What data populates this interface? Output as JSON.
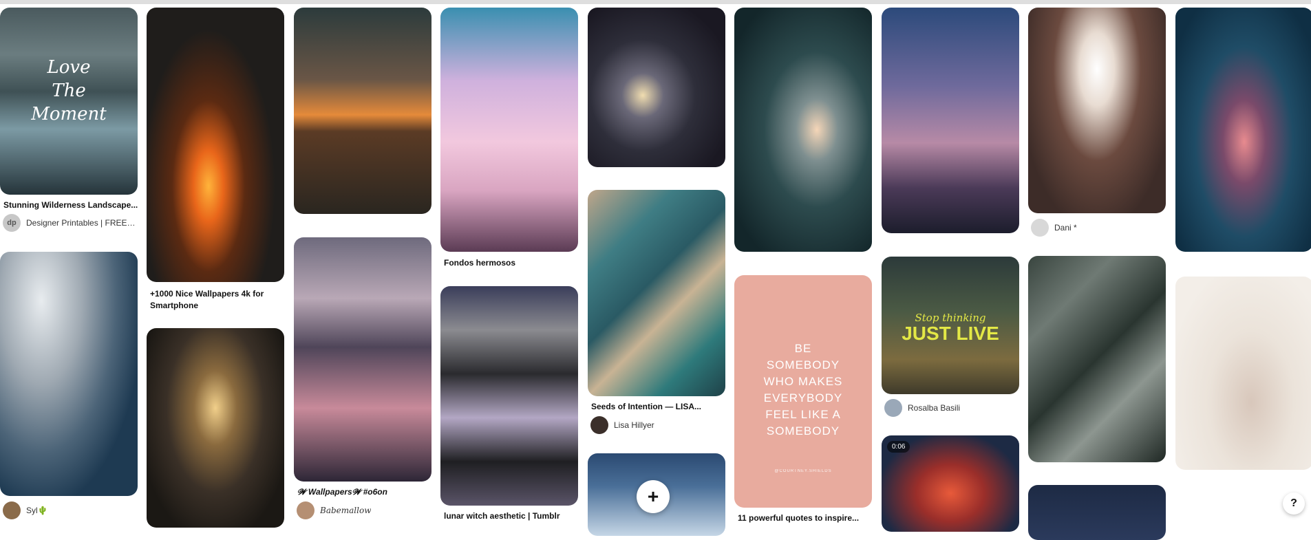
{
  "pins": {
    "wilderness": {
      "overlay": "Love The Moment",
      "title": "Stunning Wilderness Landscape...",
      "author": "Designer Printables | FREE S...",
      "avatar_text": "dp"
    },
    "campfire": {
      "title": "+1000 Nice Wallpapers 4k for Smartphone"
    },
    "dandelion": {
      "title": "Fondos hermosos"
    },
    "wallpapers": {
      "title": "𝓦 Wallpapers𝓦 #o6on",
      "author": "Babemallow"
    },
    "sea_collage": {
      "title": "Seeds of Intention — LISA...",
      "author": "Lisa Hillyer"
    },
    "lunar": {
      "title": "lunar witch aesthetic | Tumblr"
    },
    "quote": {
      "overlay": "BE SOMEBODY WHO MAKES EVERYBODY FEEL LIKE A SOMEBODY",
      "caption": "@COURTNEY.SHIELDS",
      "title": "11 powerful quotes to inspire..."
    },
    "just_live": {
      "overlay_small": "Stop thinking",
      "overlay_big": "JUST LIVE",
      "author": "Rosalba Basili"
    },
    "video": {
      "duration": "0:06"
    },
    "sparkler": {
      "author": "Dani *"
    },
    "clouds": {
      "author": "Syl🌵"
    }
  },
  "buttons": {
    "add": "+",
    "help": "?"
  },
  "colors": {
    "title": "#111111",
    "author": "#333333",
    "quote_bg": "#e8ab9e",
    "just_live": "#e3e846"
  }
}
